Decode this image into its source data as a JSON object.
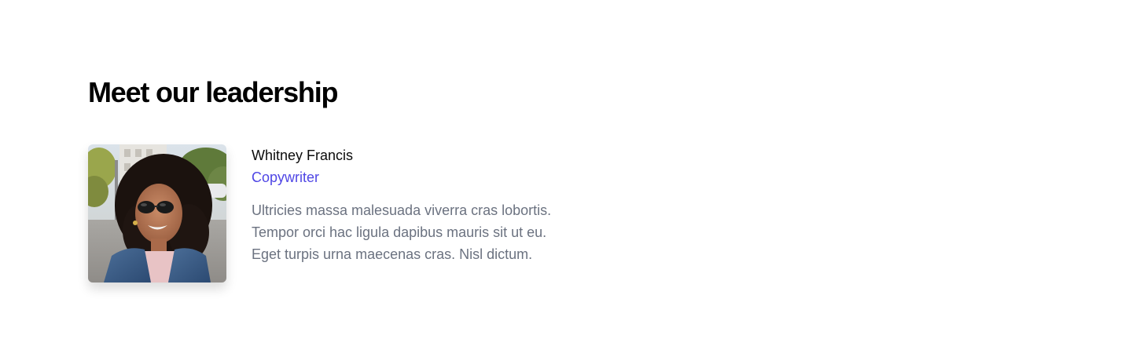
{
  "section": {
    "heading": "Meet our leadership"
  },
  "people": [
    {
      "name": "Whitney Francis",
      "role": "Copywriter",
      "bio_lines": [
        "Ultricies massa malesuada viverra cras lobortis.",
        "Tempor orci hac ligula dapibus mauris sit ut eu.",
        "Eget turpis urna maecenas cras. Nisl dictum."
      ],
      "photo": "portrait-photo"
    }
  ],
  "colors": {
    "heading": "#000000",
    "name": "#0b0b0b",
    "role_accent": "#4f46e5",
    "bio_text": "#6b7280",
    "background": "#ffffff"
  }
}
